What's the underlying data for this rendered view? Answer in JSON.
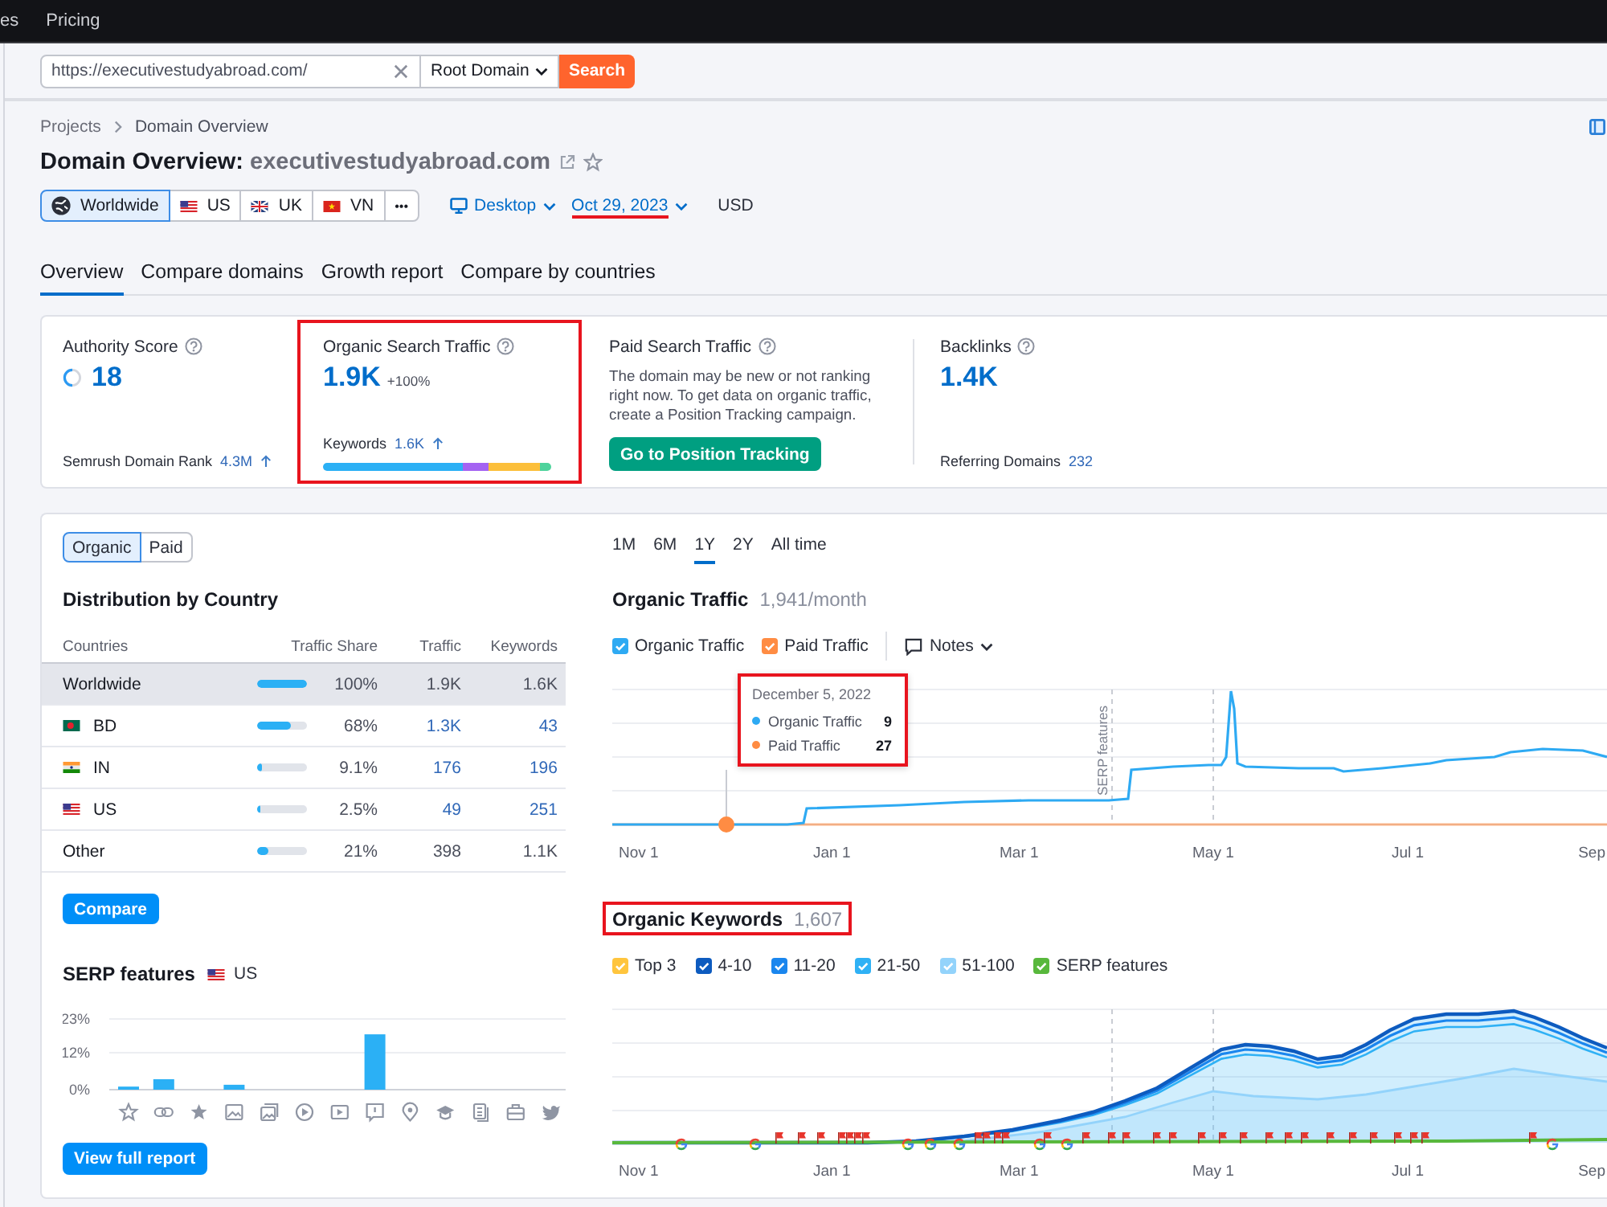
{
  "top_nav": {
    "items": [
      {
        "label": "es"
      },
      {
        "label": "Pricing"
      }
    ]
  },
  "search_bar": {
    "value": "https://executivestudyabroad.com/",
    "scope": "Root Domain",
    "button": "Search"
  },
  "breadcrumbs": [
    {
      "label": "Projects"
    },
    {
      "label": "Domain Overview"
    }
  ],
  "header": {
    "title": "Domain Overview:",
    "domain": "executivestudyabroad.com"
  },
  "filters": {
    "databases": [
      {
        "kind": "globe",
        "label": "Worldwide",
        "selected": true
      },
      {
        "kind": "us",
        "label": "US",
        "selected": false
      },
      {
        "kind": "uk",
        "label": "UK",
        "selected": false
      },
      {
        "kind": "vn",
        "label": "VN",
        "selected": false
      },
      {
        "kind": "more",
        "label": "•••",
        "selected": false
      }
    ],
    "device": "Desktop",
    "date": {
      "label": "Oct 29, 2023",
      "highlighted": true
    },
    "currency": "USD"
  },
  "tabs": [
    {
      "label": "Overview",
      "selected": true
    },
    {
      "label": "Compare domains",
      "selected": false
    },
    {
      "label": "Growth report",
      "selected": false
    },
    {
      "label": "Compare by countries",
      "selected": false
    }
  ],
  "summary_cards": [
    {
      "kind": "score",
      "title": "Authority Score",
      "value": "18",
      "footer_label": "Semrush Domain Rank",
      "footer_value": "4.3M",
      "trend_up": true,
      "highlighted": false
    },
    {
      "kind": "metric",
      "title": "Organic Search Traffic",
      "value": "1.9K",
      "change": "+100%",
      "footer_label": "Keywords",
      "footer_value": "1.6K",
      "trend_up": true,
      "intent_bar": true,
      "highlighted": true
    },
    {
      "kind": "empty",
      "title": "Paid Search Traffic",
      "description": "The domain may be new or not ranking right now. To get data on organic traffic, create a Position Tracking campaign.",
      "button": "Go to Position Tracking",
      "highlighted": false
    },
    {
      "kind": "metric",
      "title": "Backlinks",
      "value": "1.4K",
      "footer_label": "Referring Domains",
      "footer_value": "232",
      "trend_up": false,
      "highlighted": false
    }
  ],
  "distribution": {
    "toggle": [
      {
        "label": "Organic",
        "selected": true
      },
      {
        "label": "Paid",
        "selected": false
      }
    ],
    "title": "Distribution by Country",
    "columns": [
      "Countries",
      "Traffic Share",
      "Traffic",
      "Keywords"
    ],
    "rows": [
      {
        "kind": "worldwide",
        "country": "Worldwide",
        "level": 1,
        "share": "100%",
        "traffic": "1.9K",
        "keywords": "1.6K",
        "selected": true,
        "linked": false
      },
      {
        "kind": "bd",
        "country": "BD",
        "level": 0.68,
        "share": "68%",
        "traffic": "1.3K",
        "keywords": "43",
        "selected": false,
        "linked": true
      },
      {
        "kind": "in",
        "country": "IN",
        "level": 0.091,
        "share": "9.1%",
        "traffic": "176",
        "keywords": "196",
        "selected": false,
        "linked": true
      },
      {
        "kind": "us",
        "country": "US",
        "level": 0.025,
        "share": "2.5%",
        "traffic": "49",
        "keywords": "251",
        "selected": false,
        "linked": true
      },
      {
        "kind": "other",
        "country": "Other",
        "level": 0.21,
        "share": "21%",
        "traffic": "398",
        "keywords": "1.1K",
        "selected": false,
        "linked": false
      }
    ],
    "button": "Compare"
  },
  "serp_features": {
    "title": "SERP features",
    "country": {
      "kind": "us",
      "label": "US"
    },
    "chart_data": {
      "type": "bar",
      "values": [
        1,
        3.4,
        0,
        1.6,
        0,
        0,
        0,
        18,
        0,
        0,
        0,
        0,
        0
      ],
      "ylim": [
        0,
        23
      ],
      "yticks": [
        {
          "value": 0,
          "label": "0%"
        },
        {
          "value": 12,
          "label": "12%"
        },
        {
          "value": 23,
          "label": "23%"
        }
      ]
    },
    "button": "View full report"
  },
  "traffic_chart": {
    "periods": [
      {
        "label": "1M",
        "selected": false
      },
      {
        "label": "6M",
        "selected": false
      },
      {
        "label": "1Y",
        "selected": true
      },
      {
        "label": "2Y",
        "selected": false
      },
      {
        "label": "All time",
        "selected": false
      }
    ],
    "title": "Organic Traffic",
    "value": "1,941/month",
    "legend": [
      {
        "label": "Organic Traffic",
        "checked": true,
        "color": "#2eaaf3"
      },
      {
        "label": "Paid Traffic",
        "checked": true,
        "color": "#ff8c43"
      }
    ],
    "notes": "Notes",
    "annotation": "SERP features",
    "tooltip": {
      "date": "December 5, 2022",
      "highlighted": true,
      "rows": [
        {
          "label": "Organic Traffic",
          "value": "9",
          "color": "#2eaaf3"
        },
        {
          "label": "Paid Traffic",
          "value": "27",
          "color": "#ff8c43"
        }
      ]
    },
    "x_labels": [
      "Nov 1",
      "Jan 1",
      "Mar 1",
      "May 1",
      "Jul 1",
      "Sep"
    ]
  },
  "keywords_chart": {
    "title": "Organic Keywords",
    "value": "1,607",
    "highlighted": true,
    "legend": [
      {
        "label": "Top 3",
        "checked": true,
        "color": "#ffc53d"
      },
      {
        "label": "4-10",
        "checked": true,
        "color": "#0d5bbf"
      },
      {
        "label": "11-20",
        "checked": true,
        "color": "#1a86ee"
      },
      {
        "label": "21-50",
        "checked": true,
        "color": "#2fb1f5"
      },
      {
        "label": "51-100",
        "checked": true,
        "color": "#93d3fb"
      },
      {
        "label": "SERP features",
        "checked": true,
        "color": "#58b83c"
      }
    ],
    "x_labels": [
      "Nov 1",
      "Jan 1",
      "Mar 1",
      "May 1",
      "Jul 1",
      "Sep"
    ]
  }
}
